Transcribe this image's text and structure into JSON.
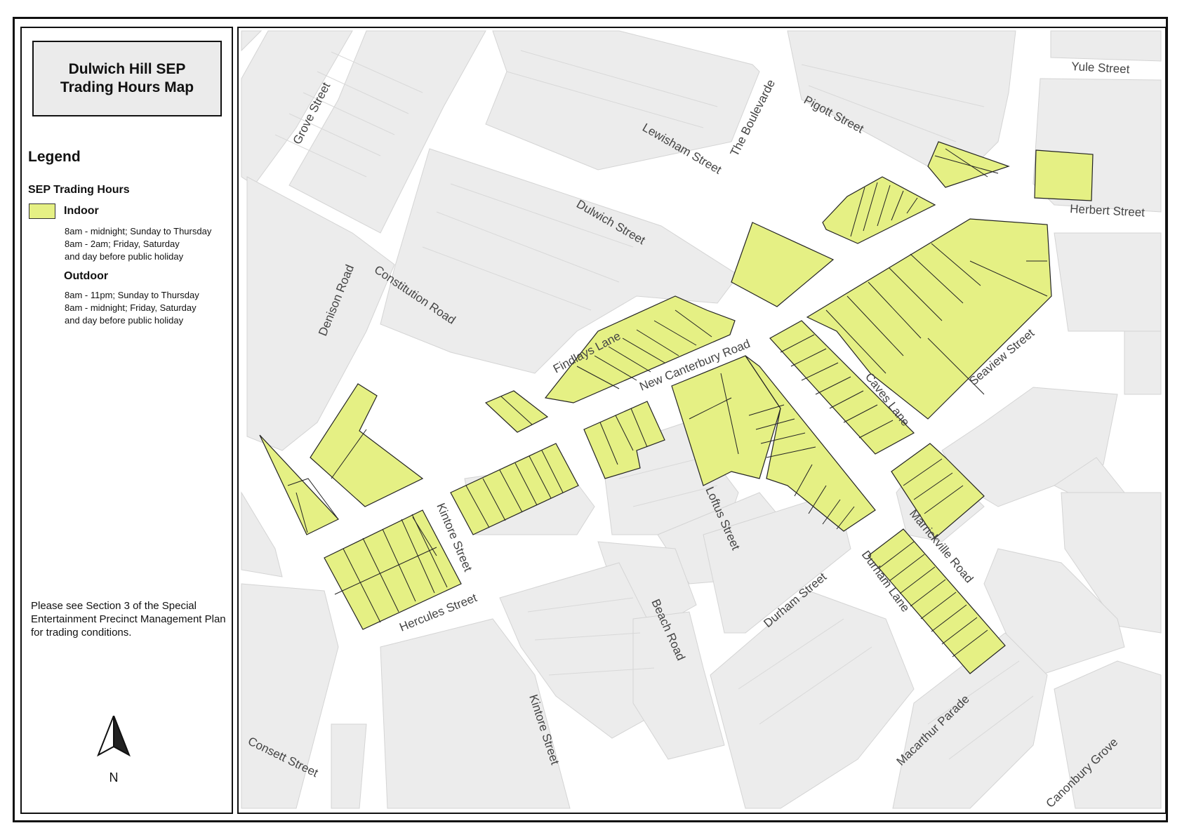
{
  "title": {
    "line1": "Dulwich Hill SEP",
    "line2": "Trading Hours Map"
  },
  "legend": {
    "heading": "Legend",
    "subheading": "SEP Trading Hours",
    "indoor": {
      "label": "Indoor",
      "line1": "8am - midnight; Sunday to Thursday",
      "line2": "8am - 2am; Friday, Saturday",
      "line3": "and day before public holiday",
      "color": "#e5f084"
    },
    "outdoor": {
      "label": "Outdoor",
      "line1": "8am - 11pm; Sunday to Thursday",
      "line2": "8am - midnight; Friday, Saturday",
      "line3": "and day before public holiday"
    }
  },
  "note": "Please see Section 3 of the Special Entertainment Precinct Management Plan for trading conditions.",
  "north_arrow": {
    "label": "N"
  },
  "streets": {
    "grove": "Grove Street",
    "lewisham": "Lewisham Street",
    "boulevarde": "The Boulevarde",
    "pigott": "Pigott Street",
    "yule": "Yule Street",
    "herbert": "Herbert Street",
    "dulwich": "Dulwich Street",
    "denison": "Denison Road",
    "constitution": "Constitution Road",
    "findlays": "Findlays Lane",
    "new_canterbury": "New Canterbury Road",
    "caves": "Caves Lane",
    "seaview": "Seaview Street",
    "kintore_north": "Kintore Street",
    "kintore_south": "Kintore Street",
    "loftus": "Loftus Street",
    "hercules": "Hercules Street",
    "beach": "Beach Road",
    "durham_street": "Durham Street",
    "durham_lane": "Durham Lane",
    "marrickville": "Marrickville Road",
    "macarthur": "Macarthur Parade",
    "consett": "Consett Street",
    "canonbury": "Canonbury Grove"
  }
}
